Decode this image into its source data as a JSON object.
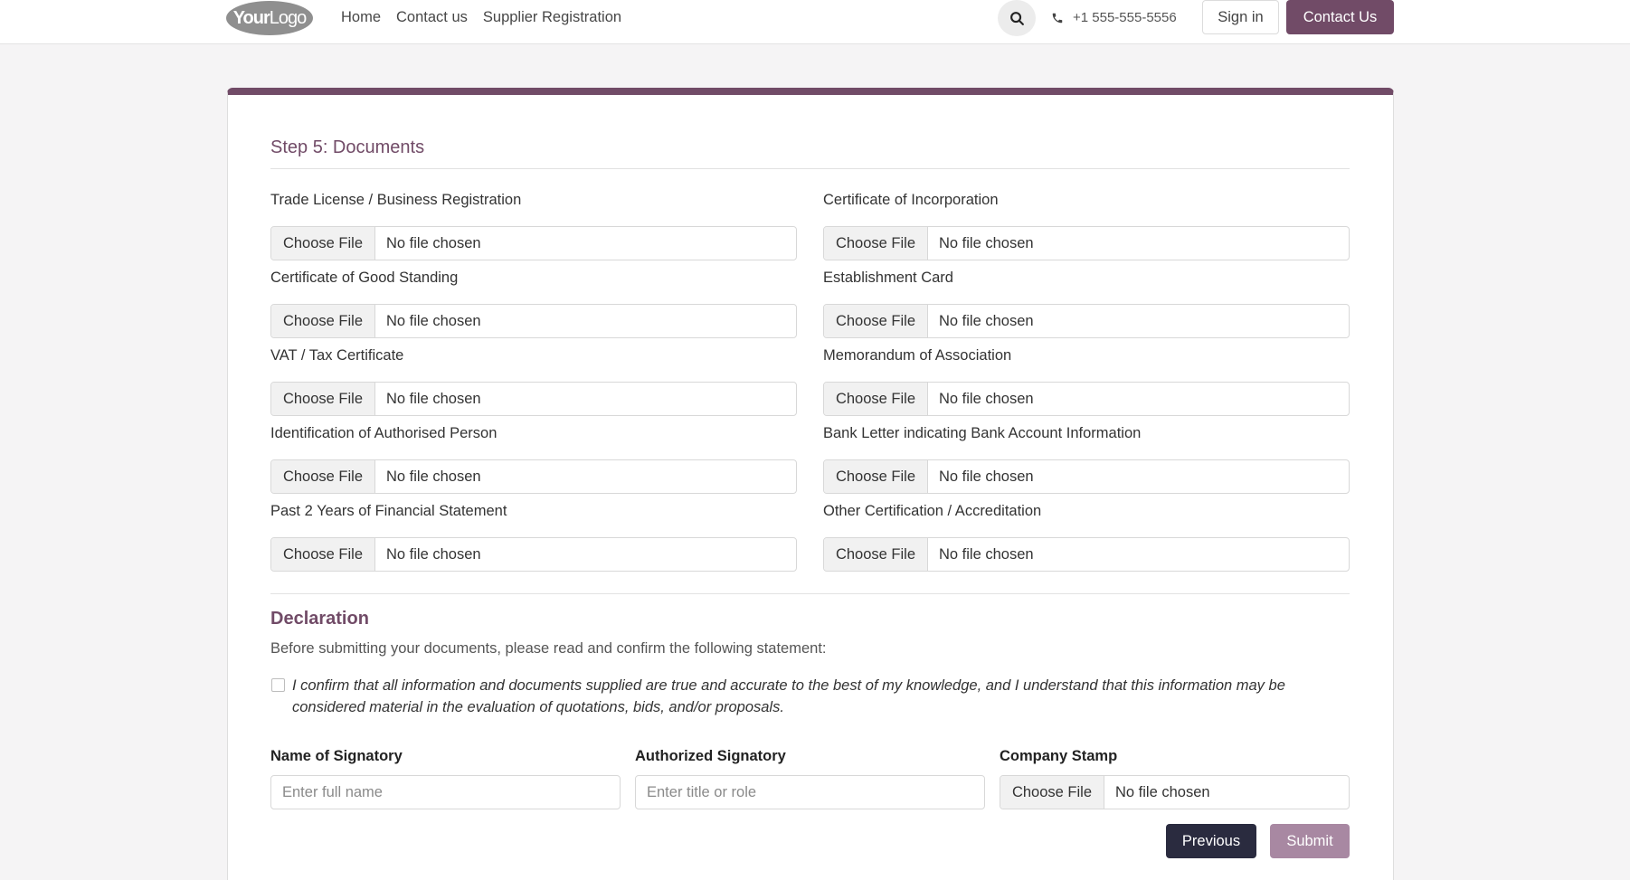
{
  "header": {
    "logo": {
      "bold": "Your",
      "light": "Logo"
    },
    "nav": [
      "Home",
      "Contact us",
      "Supplier Registration"
    ],
    "phone": "+1 555-555-5556",
    "signin": "Sign in",
    "contact": "Contact Us"
  },
  "form": {
    "step_title": "Step 5: Documents",
    "choose_label": "Choose File",
    "no_file": "No file chosen",
    "documents": [
      "Trade License / Business Registration",
      "Certificate of Incorporation",
      "Certificate of Good Standing",
      "Establishment Card",
      "VAT / Tax Certificate",
      "Memorandum of Association",
      "Identification of Authorised Person",
      "Bank Letter indicating Bank Account Information",
      "Past 2 Years of Financial Statement",
      "Other Certification / Accreditation"
    ],
    "declaration": {
      "title": "Declaration",
      "intro": "Before submitting your documents, please read and confirm the following statement:",
      "confirm": "I confirm that all information and documents supplied are true and accurate to the best of my knowledge, and I understand that this information may be considered material in the evaluation of quotations, bids, and/or proposals.",
      "checked": false
    },
    "signatory": {
      "name_label": "Name of Signatory",
      "name_placeholder": "Enter full name",
      "auth_label": "Authorized Signatory",
      "auth_placeholder": "Enter title or role",
      "stamp_label": "Company Stamp"
    },
    "buttons": {
      "previous": "Previous",
      "submit": "Submit"
    }
  },
  "colors": {
    "brand": "#714b67",
    "dark_button": "#2a2b3f",
    "submit_disabled": "#a888a2"
  }
}
